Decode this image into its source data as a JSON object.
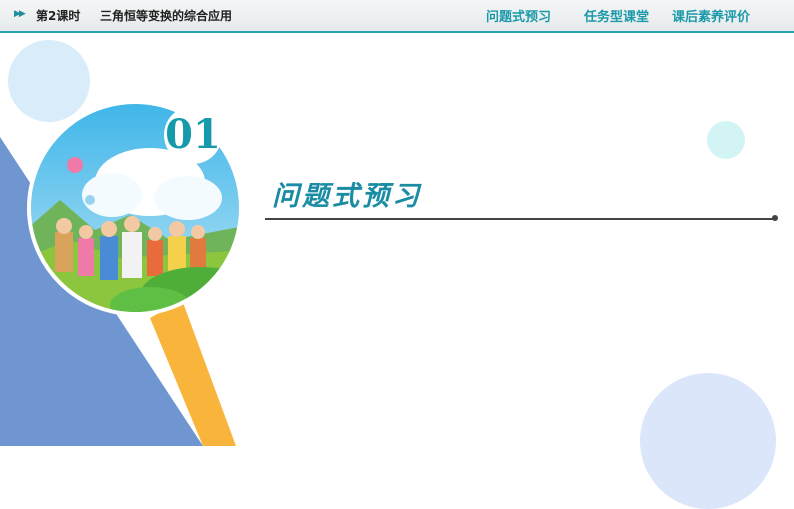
{
  "header": {
    "arrow_icon": "double-chevron-right-icon",
    "lesson": "第2课时",
    "title": "三角恒等变换的综合应用",
    "nav": [
      "问题式预习",
      "任务型课堂",
      "课后素养评价"
    ]
  },
  "section": {
    "number": "01",
    "heading": "问题式预习"
  },
  "colors": {
    "accent": "#1a9aa8",
    "triangle_blue": "#6f96d1",
    "stripe_orange": "#f9b43c"
  }
}
